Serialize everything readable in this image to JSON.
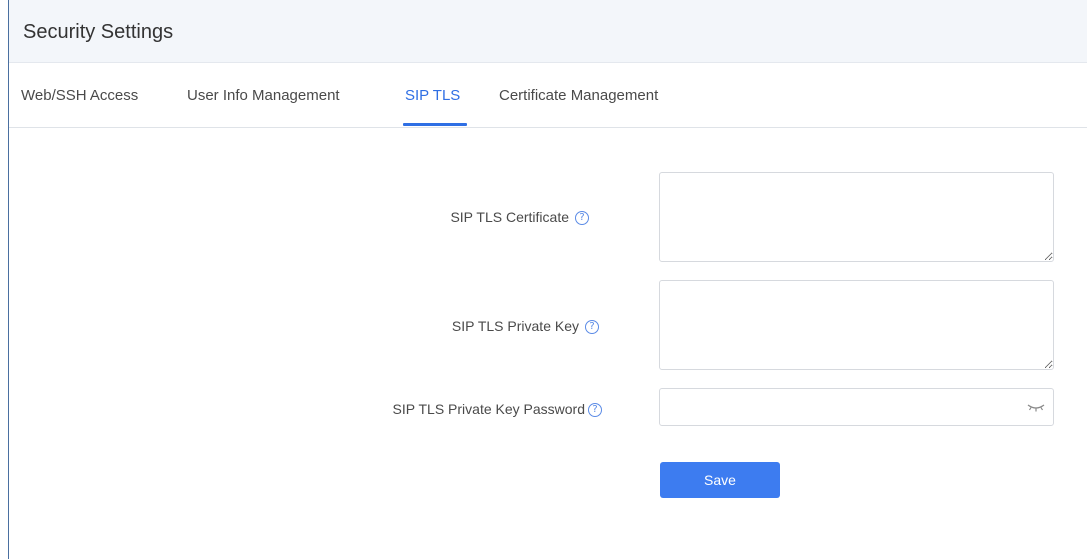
{
  "header": {
    "title": "Security Settings"
  },
  "tabs": [
    {
      "label": "Web/SSH Access",
      "active": false
    },
    {
      "label": "User Info Management",
      "active": false
    },
    {
      "label": "SIP TLS",
      "active": true
    },
    {
      "label": "Certificate Management",
      "active": false
    }
  ],
  "form": {
    "fields": [
      {
        "label": "SIP TLS Certificate",
        "type": "textarea",
        "value": "",
        "help_icon": "question-circle-icon"
      },
      {
        "label": "SIP TLS Private Key",
        "type": "textarea",
        "value": "",
        "help_icon": "question-circle-icon"
      },
      {
        "label": "SIP TLS Private Key Password",
        "type": "password",
        "value": "",
        "help_icon": "question-circle-icon",
        "trailing_icon": "eye-closed-icon"
      }
    ],
    "save_label": "Save"
  },
  "colors": {
    "accent": "#2f6fe4",
    "button": "#3d7cf0",
    "header_bg": "#f3f6fa",
    "frame_border": "#4a6fa0"
  }
}
